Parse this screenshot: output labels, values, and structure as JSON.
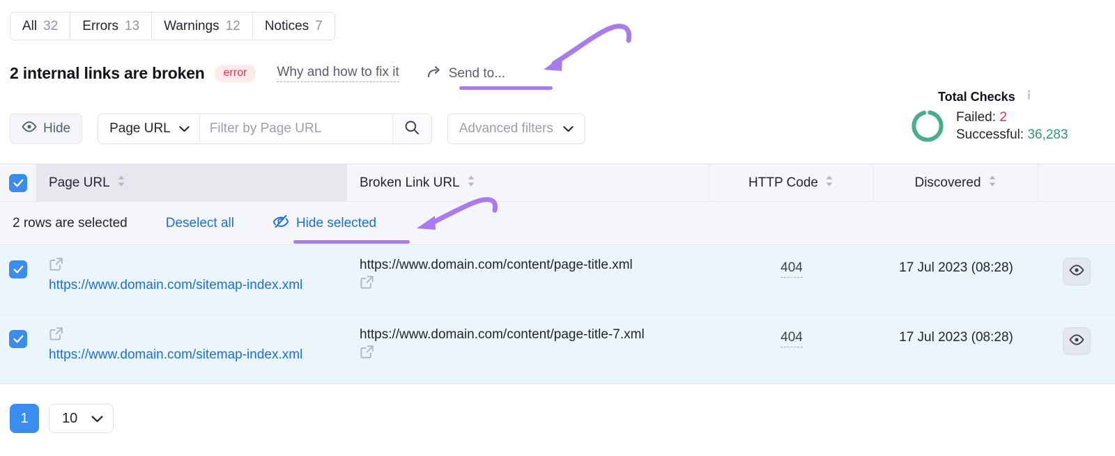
{
  "tabs": [
    {
      "label": "All",
      "count": "32"
    },
    {
      "label": "Errors",
      "count": "13"
    },
    {
      "label": "Warnings",
      "count": "12"
    },
    {
      "label": "Notices",
      "count": "7"
    }
  ],
  "header": {
    "title": "2 internal links are broken",
    "badge": "error",
    "fix_link": "Why and how to fix it",
    "send_to": "Send to...",
    "send_to_icon": "share-arrow-icon"
  },
  "toolbar": {
    "hide_label": "Hide",
    "hide_icon": "eye-icon",
    "filter_field": "Page URL",
    "filter_placeholder": "Filter by Page URL",
    "filter_value": "",
    "search_icon": "search-icon",
    "advanced_filters": "Advanced filters"
  },
  "total_checks": {
    "title": "Total Checks",
    "info_icon": "info-icon",
    "failed_label": "Failed:",
    "failed_value": "2",
    "successful_label": "Successful:",
    "successful_value": "36,283",
    "donut_success_pct": 93,
    "color_success": "#4bae8a",
    "color_failed": "#e8304e",
    "color_track": "#e9ecf2"
  },
  "table": {
    "columns": [
      {
        "label": "Page URL",
        "sort_icon": "sort-arrows-icon"
      },
      {
        "label": "Broken Link URL",
        "sort_icon": "sort-arrows-icon"
      },
      {
        "label": "HTTP Code",
        "sort_icon": "sort-arrows-icon"
      },
      {
        "label": "Discovered",
        "sort_icon": "sort-arrows-icon"
      }
    ],
    "select_all_checked": true,
    "selection_bar": {
      "text": "2 rows are selected",
      "deselect_all": "Deselect all",
      "hide_selected": "Hide selected",
      "hide_selected_icon": "eye-off-icon"
    },
    "rows": [
      {
        "checked": true,
        "page_url": "https://www.domain.com/sitemap-index.xml",
        "broken_link_url": "https://www.domain.com/content/page-title.xml",
        "http_code": "404",
        "discovered": "17 Jul 2023 (08:28)",
        "action_icon": "eye-icon",
        "link_icon": "external-link-icon"
      },
      {
        "checked": true,
        "page_url": "https://www.domain.com/sitemap-index.xml",
        "broken_link_url": "https://www.domain.com/content/page-title-7.xml",
        "http_code": "404",
        "discovered": "17 Jul 2023 (08:28)",
        "action_icon": "eye-icon",
        "link_icon": "external-link-icon"
      }
    ]
  },
  "pagination": {
    "page": "1",
    "page_size": "10",
    "chevron_icon": "chevron-down-icon"
  },
  "annotations": {
    "color": "#a87bf0",
    "arrow_send_to": "arrow-pointing-to-send-to",
    "arrow_hide_selected": "arrow-pointing-to-hide-selected"
  }
}
